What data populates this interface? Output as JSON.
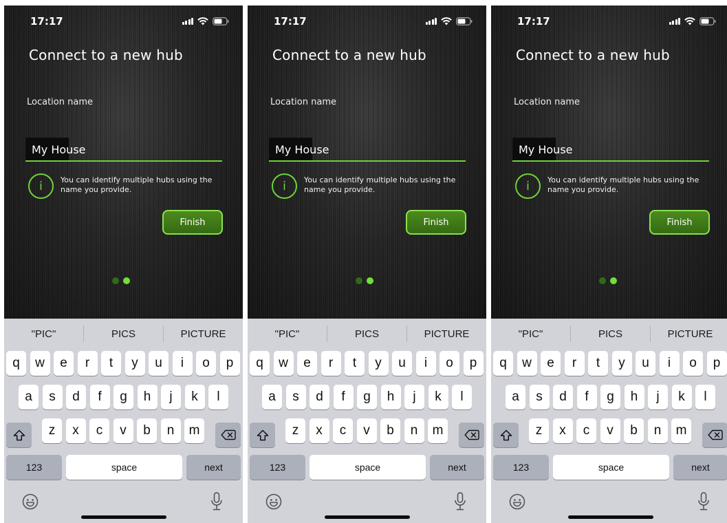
{
  "status": {
    "time": "17:17"
  },
  "screen": {
    "title": "Connect to a new hub",
    "field_label": "Location name",
    "field_value": "My House",
    "info_text": "You can identify multiple hubs using the name you provide.",
    "finish_label": "Finish",
    "info_icon_glyph": "i",
    "page_indicator": {
      "current": 2,
      "total": 2
    }
  },
  "keyboard": {
    "suggestions": [
      "\"PIC\"",
      "PICS",
      "PICTURE"
    ],
    "row1": [
      "q",
      "w",
      "e",
      "r",
      "t",
      "y",
      "u",
      "i",
      "o",
      "p"
    ],
    "row2": [
      "a",
      "s",
      "d",
      "f",
      "g",
      "h",
      "j",
      "k",
      "l"
    ],
    "row3": [
      "z",
      "x",
      "c",
      "v",
      "b",
      "n",
      "m"
    ],
    "numbers_label": "123",
    "space_label": "space",
    "next_label": "next",
    "icons": [
      "shift-icon",
      "backspace-icon",
      "emoji-icon",
      "microphone-icon"
    ]
  },
  "colors": {
    "accent_green": "#6fd437",
    "button_fill": "#3d7a18",
    "app_background": "#1e1e1e",
    "keyboard_background": "#d1d3d9"
  }
}
